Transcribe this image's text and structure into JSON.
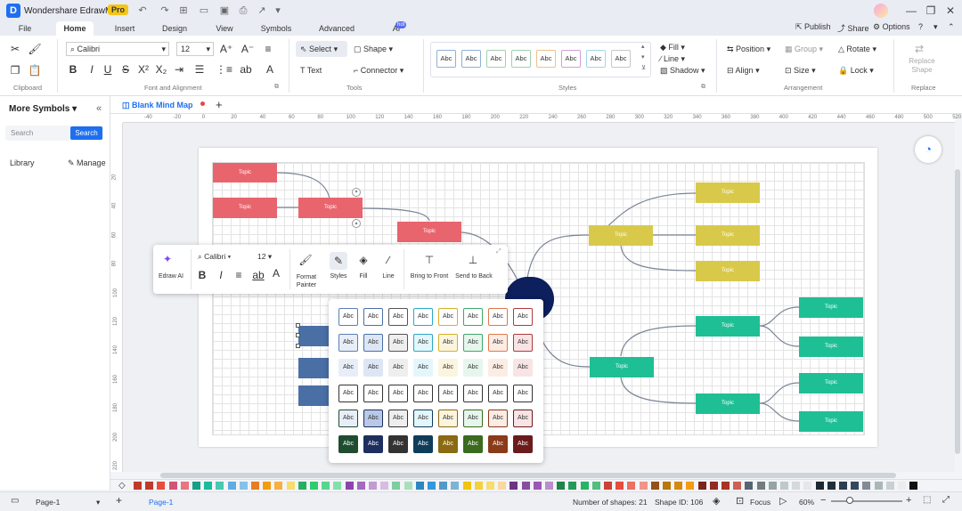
{
  "app": {
    "title": "Wondershare EdrawMax",
    "badge": "Pro"
  },
  "menu": {
    "tabs": [
      "File",
      "Home",
      "Insert",
      "Design",
      "View",
      "Symbols",
      "Advanced",
      "AI"
    ],
    "ai_badge": "hot",
    "actions": {
      "publish": "Publish",
      "share": "Share",
      "options": "Options"
    }
  },
  "ribbon": {
    "font_name": "Calibri",
    "font_size": "12",
    "select": "Select",
    "shape": "Shape",
    "text": "Text",
    "connector": "Connector",
    "fill": "Fill",
    "line": "Line",
    "shadow": "Shadow",
    "position": "Position",
    "group": "Group",
    "rotate": "Rotate",
    "align": "Align",
    "size": "Size",
    "lock": "Lock",
    "replace_shape": "Replace Shape",
    "style_swatch": "Abc",
    "groups": {
      "clipboard": "Clipboard",
      "font": "Font and Alignment",
      "tools": "Tools",
      "styles": "Styles",
      "arrangement": "Arrangement",
      "replace": "Replace"
    }
  },
  "left_panel": {
    "title": "More Symbols",
    "search_placeholder": "Search",
    "search_button": "Search",
    "library": "Library",
    "manage": "Manage"
  },
  "doc_tab": {
    "name": "Blank Mind Map"
  },
  "ruler": {
    "top": [
      "-40",
      "-20",
      "0",
      "20",
      "40",
      "60",
      "80",
      "100",
      "120",
      "140",
      "160",
      "180",
      "200",
      "220",
      "240",
      "260",
      "280",
      "300",
      "320",
      "340",
      "360",
      "380",
      "400",
      "420",
      "440",
      "460",
      "480",
      "500",
      "520"
    ],
    "left": [
      "20",
      "40",
      "60",
      "80",
      "100",
      "120",
      "140",
      "160",
      "180",
      "200",
      "220"
    ]
  },
  "diagram": {
    "topic_label": "Topic"
  },
  "float_toolbar": {
    "edraw_ai": "Edraw AI",
    "font": "Calibri",
    "size": "12",
    "format_painter": "Format Painter",
    "styles": "Styles",
    "fill": "Fill",
    "line": "Line",
    "bring_front": "Bring to Front",
    "send_back": "Send to Back"
  },
  "style_popup": {
    "label": "Abc"
  },
  "status": {
    "page_selector": "Page-1",
    "page_tab": "Page-1",
    "shape_count": "Number of shapes: 21",
    "shape_id": "Shape ID: 106",
    "focus": "Focus",
    "zoom": "60%"
  },
  "colors": {
    "red_topic": "#e8656e",
    "yellow_topic": "#d8c94a",
    "green_topic": "#1fbf95",
    "blue_topic": "#4a6fa5",
    "central": "#0d1f5c",
    "accent": "#1e6ff0"
  }
}
